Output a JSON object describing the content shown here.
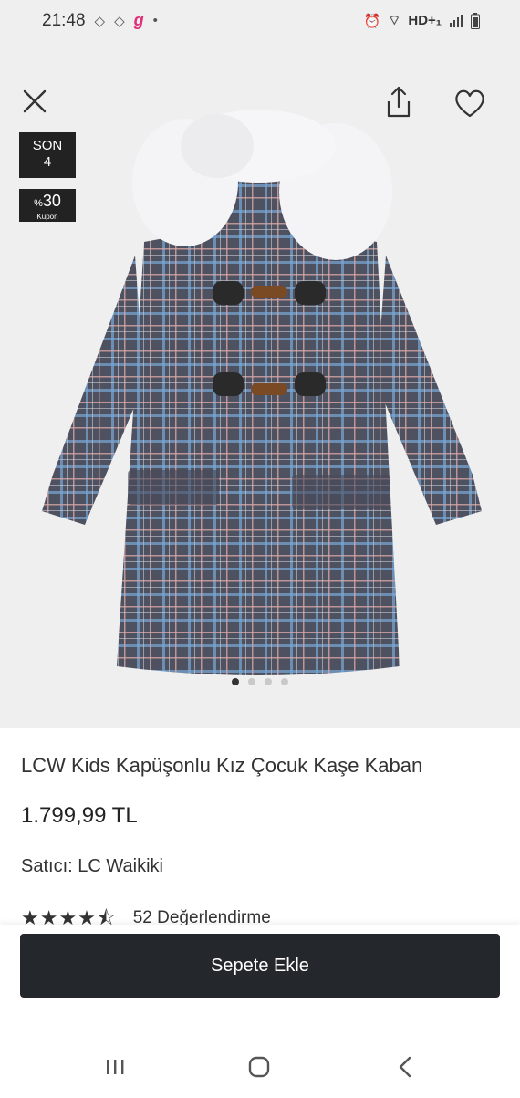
{
  "status_bar": {
    "time": "21:48",
    "network": "HD+₁"
  },
  "gallery": {
    "badge_son_line1": "SON",
    "badge_son_line2": "4",
    "coupon_pct": "30",
    "coupon_prefix": "%",
    "coupon_label": "Kupon",
    "image_count": 4,
    "active_index": 0
  },
  "product": {
    "title": "LCW Kids Kapüşonlu Kız Çocuk Kaşe Kaban",
    "price": "1.799,99 TL",
    "seller_label": "Satıcı:",
    "seller_name": "LC Waikiki",
    "rating_value": 4.5,
    "rating_count_text": "52 Değerlendirme"
  },
  "actions": {
    "add_to_cart": "Sepete Ekle"
  },
  "colors": {
    "button_bg": "#24272b",
    "gallery_bg": "#efefef"
  }
}
